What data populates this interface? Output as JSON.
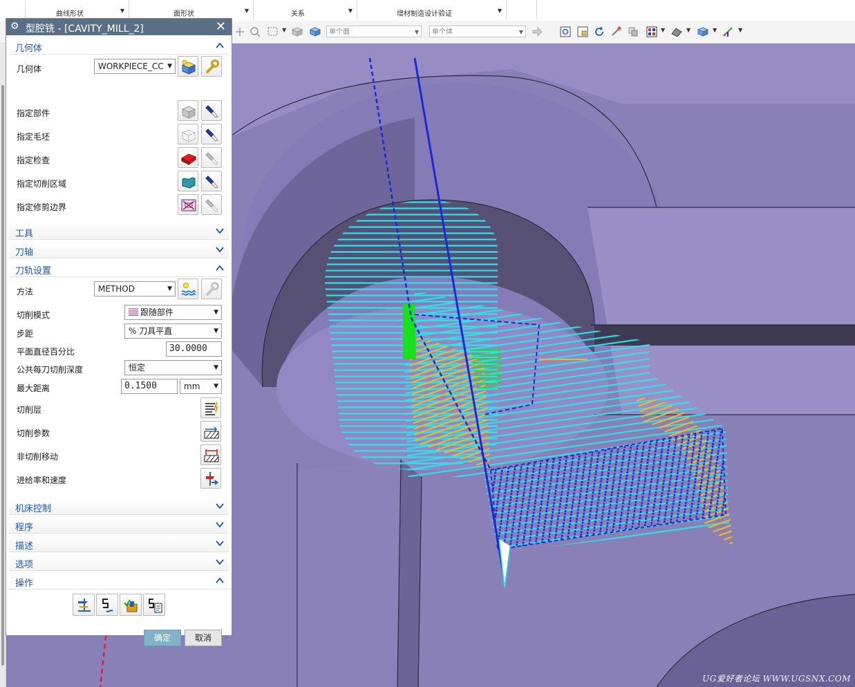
{
  "ribbon": {
    "groups": [
      {
        "label": "曲线形状"
      },
      {
        "label": "面形状"
      },
      {
        "label": "关系"
      },
      {
        "label": "增材制造设计验证"
      }
    ]
  },
  "toolbar": {
    "face_filter": "单个面",
    "body_filter": "单个体"
  },
  "dialog": {
    "title": "型腔铣 - [CAVITY_MILL_2]",
    "sections": {
      "geometry": {
        "label": "几何体",
        "expanded": true,
        "geometry_label": "几何体",
        "geometry_value": "WORKPIECE_CC",
        "specify_part": "指定部件",
        "specify_blank": "指定毛坯",
        "specify_check": "指定检查",
        "specify_cut_area": "指定切削区域",
        "specify_trim_boundary": "指定修剪边界"
      },
      "tool": {
        "label": "工具",
        "expanded": false
      },
      "axis": {
        "label": "刀轴",
        "expanded": false
      },
      "path_settings": {
        "label": "刀轨设置",
        "expanded": true,
        "method_label": "方法",
        "method_value": "METHOD",
        "cut_pattern_label": "切削模式",
        "cut_pattern_value": "跟随部件",
        "stepover_label": "步距",
        "stepover_value": "% 刀具平直",
        "flat_diameter_label": "平面直径百分比",
        "flat_diameter_value": "30.0000",
        "depth_per_cut_label": "公共每刀切削深度",
        "depth_per_cut_value": "恒定",
        "max_distance_label": "最大距离",
        "max_distance_value": "0.1500",
        "max_distance_unit": "mm",
        "cut_levels_label": "切削层",
        "cut_params_label": "切削参数",
        "non_cut_moves_label": "非切削移动",
        "feeds_speeds_label": "进给率和速度"
      },
      "machine_control": {
        "label": "机床控制",
        "expanded": false
      },
      "program": {
        "label": "程序",
        "expanded": false
      },
      "description": {
        "label": "描述",
        "expanded": false
      },
      "options": {
        "label": "选项",
        "expanded": false
      },
      "operations": {
        "label": "操作",
        "expanded": true
      }
    },
    "ok_label": "确定",
    "cancel_label": "取消"
  },
  "viewport": {
    "watermark": "UG爱好者论坛 WWW.UGSNX.COM",
    "colors": {
      "background": "#7f76ae",
      "toolpath_cyan": "#27e6ef",
      "toolpath_orange": "#f5b521",
      "toolpath_blue": "#1a28d6",
      "toolpath_green": "#18e21c",
      "axis_red": "#e0202a"
    }
  }
}
